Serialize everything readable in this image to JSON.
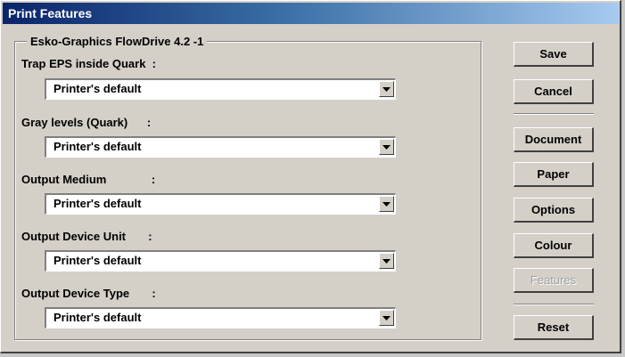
{
  "window": {
    "title": "Print Features"
  },
  "group": {
    "title": "Esko-Graphics FlowDrive 4.2 -1"
  },
  "fields": [
    {
      "label": "Trap EPS inside Quark  :",
      "value": "Printer's default"
    },
    {
      "label": "Gray levels (Quark)      :",
      "value": "Printer's default"
    },
    {
      "label": "Output Medium              :",
      "value": "Printer's default"
    },
    {
      "label": "Output Device Unit       :",
      "value": "Printer's default"
    },
    {
      "label": "Output Device Type       :",
      "value": "Printer's default"
    }
  ],
  "buttons": {
    "save": "Save",
    "cancel": "Cancel",
    "document": "Document",
    "paper": "Paper",
    "options": "Options",
    "colour": "Colour",
    "features": "Features",
    "reset": "Reset"
  },
  "icons": {
    "dropdown": "chevron-down-icon"
  },
  "colors": {
    "titlebar_start": "#0a246a",
    "titlebar_end": "#a6caf0",
    "face": "#d4d0c8"
  }
}
